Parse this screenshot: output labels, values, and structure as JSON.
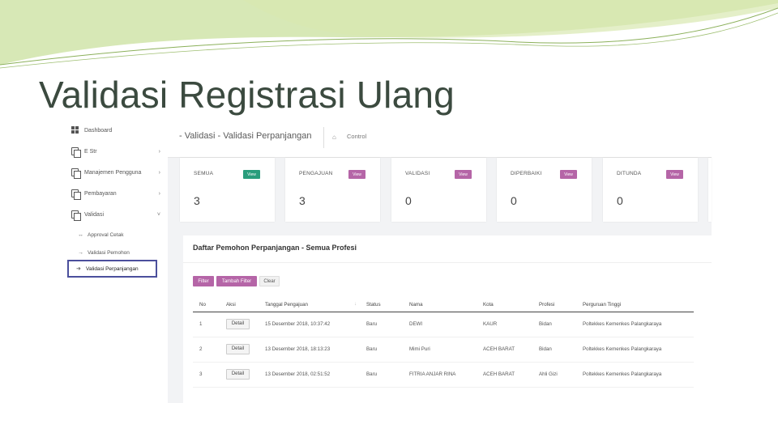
{
  "slide_title": "Validasi Registrasi Ulang",
  "colors": {
    "accent_purple": "#b565a7",
    "accent_green": "#2a9d7c",
    "deco_green": "#b7d67a",
    "active_border": "#4b4f9c"
  },
  "sidebar": {
    "items": [
      {
        "label": "Dashboard",
        "icon": "dashboard-grid-icon"
      },
      {
        "label": "E Str",
        "icon": "copy-icon",
        "chevron": "›"
      },
      {
        "label": "Manajemen Pengguna",
        "icon": "copy-icon",
        "chevron": "›"
      },
      {
        "label": "Pembayaran",
        "icon": "copy-icon",
        "chevron": "›"
      },
      {
        "label": "Validasi",
        "icon": "copy-icon",
        "chevron": "˅"
      }
    ],
    "subitems": [
      {
        "label": "Approval Cetak",
        "arrow": "↔"
      },
      {
        "label": "Validasi Pemohon",
        "arrow": "→"
      },
      {
        "label": "Validasi Perpanjangan",
        "arrow": "➜",
        "active": true
      }
    ]
  },
  "topbar": {
    "title": "- Validasi - Validasi Perpanjangan",
    "home_icon": "⌂",
    "crumb": "Control"
  },
  "cards": [
    {
      "label": "SEMUA",
      "button": "View",
      "value": "3",
      "color": "#2a9d7c"
    },
    {
      "label": "PENGAJUAN",
      "button": "View",
      "value": "3",
      "color": "#b565a7"
    },
    {
      "label": "VALIDASI",
      "button": "View",
      "value": "0",
      "color": "#b565a7"
    },
    {
      "label": "DIPERBAIKI",
      "button": "View",
      "value": "0",
      "color": "#b565a7"
    },
    {
      "label": "DITUNDA",
      "button": "View",
      "value": "0",
      "color": "#b565a7"
    }
  ],
  "panel": {
    "title": "Daftar Pemohon Perpanjangan - Semua Profesi",
    "buttons": {
      "filter": "Filter",
      "add_filter": "Tambah Filter",
      "clear": "Clear"
    },
    "columns": [
      "No",
      "Aksi",
      "Tanggal Pengajuan",
      "Status",
      "Nama",
      "Kota",
      "Profesi",
      "Perguruan Tinggi"
    ],
    "rows": [
      {
        "no": "1",
        "aksi": "Detail",
        "tanggal": "15 Desember 2018, 10:37:42",
        "status": "Baru",
        "nama": "DEWI",
        "kota": "KAUR",
        "profesi": "Bidan",
        "pt": "Poltekkes Kemenkes Palangkaraya"
      },
      {
        "no": "2",
        "aksi": "Detail",
        "tanggal": "13 Desember 2018, 18:13:23",
        "status": "Baru",
        "nama": "Mimi Puri",
        "kota": "ACEH BARAT",
        "profesi": "Bidan",
        "pt": "Poltekkes Kemenkes Palangkaraya"
      },
      {
        "no": "3",
        "aksi": "Detail",
        "tanggal": "13 Desember 2018, 02:51:52",
        "status": "Baru",
        "nama": "FITRIA ANJAR RINA",
        "kota": "ACEH BARAT",
        "profesi": "Ahli Gizi",
        "pt": "Poltekkes Kemenkes Palangkaraya"
      }
    ]
  }
}
